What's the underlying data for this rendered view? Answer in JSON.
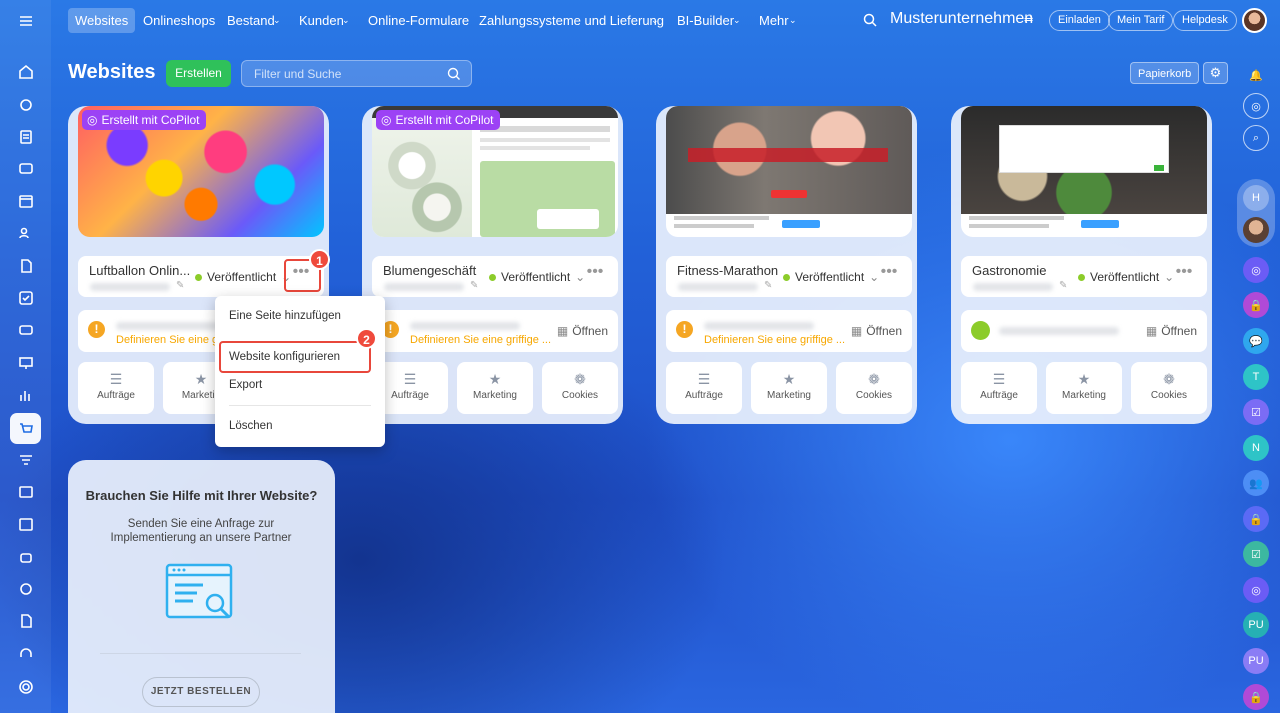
{
  "nav": {
    "items": [
      "Websites",
      "Onlineshops",
      "Bestand",
      "Kunden",
      "Online-Formulare",
      "Zahlungssysteme und Lieferung",
      "BI-Builder",
      "Mehr"
    ],
    "company": "Musterunternehmen",
    "invite": "Einladen",
    "plan": "Mein Tarif",
    "helpdesk": "Helpdesk"
  },
  "header": {
    "title": "Websites",
    "create": "Erstellen",
    "search_placeholder": "Filter und Suche",
    "trash": "Papierkorb"
  },
  "cards": [
    {
      "name": "Luftballon Onlin...",
      "status": "Veröffentlicht",
      "copilot": "Erstellt mit CoPilot",
      "define": "Definieren Sie eine gr",
      "open": "Öffnen"
    },
    {
      "name": "Blumengeschäft",
      "status": "Veröffentlicht",
      "copilot": "Erstellt mit CoPilot",
      "define": "Definieren Sie eine griffige ...",
      "open": "Öffnen"
    },
    {
      "name": "Fitness-Marathon",
      "status": "Veröffentlicht",
      "define": "Definieren Sie eine griffige ...",
      "open": "Öffnen"
    },
    {
      "name": "Gastronomie",
      "status": "Veröffentlicht",
      "open": "Öffnen"
    }
  ],
  "tiles": [
    "Aufträge",
    "Marketing",
    "Cookies"
  ],
  "tile_first_partial": "Marketin",
  "menu": {
    "items": [
      "Eine Seite hinzufügen",
      "Website konfigurieren",
      "Export",
      "Löschen"
    ]
  },
  "badges": [
    "1",
    "2"
  ],
  "help": {
    "title": "Brauchen Sie Hilfe mit Ihrer Website?",
    "text": "Senden Sie eine Anfrage zur Implementierung an unsere Partner",
    "button": "JETZT BESTELLEN"
  },
  "rightbar": [
    "H",
    "T",
    "N",
    "PU",
    "PU"
  ],
  "colors": {
    "accent": "#2fc15a",
    "copilot": "#9c42f5",
    "warning": "#f5a623",
    "highlight": "#e8473b"
  }
}
